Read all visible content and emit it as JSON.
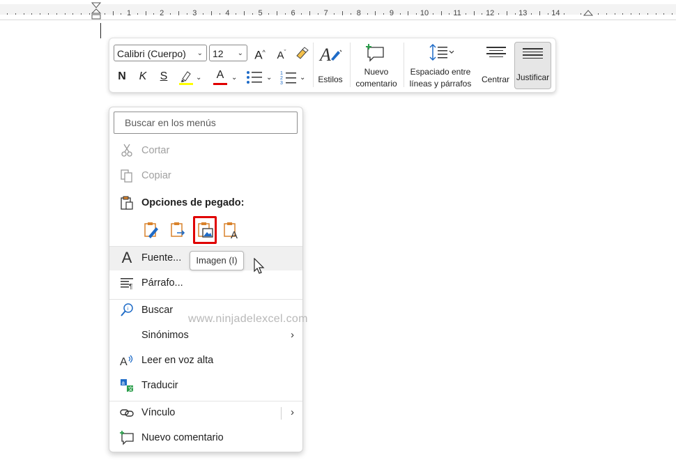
{
  "ruler": {
    "numbers": [
      "1",
      "2",
      "3",
      "4",
      "5",
      "6",
      "7",
      "8",
      "9",
      "10",
      "11",
      "12",
      "13",
      "14"
    ]
  },
  "toolbar": {
    "font_name": "Calibri (Cuerpo)",
    "font_size": "12",
    "grow_font": "A^",
    "shrink_font": "Aˇ",
    "bold": "N",
    "italic": "K",
    "underline": "S",
    "font_color_letter": "A",
    "highlight_color": "#ffff00",
    "font_color": "#e00000",
    "styles_label": "Estilos",
    "new_comment_label_1": "Nuevo",
    "new_comment_label_2": "comentario",
    "spacing_label_1": "Espaciado entre",
    "spacing_label_2": "líneas y párrafos",
    "center_label": "Centrar",
    "justify_label": "Justificar"
  },
  "menu": {
    "search_placeholder": "Buscar en los menús",
    "cut": "Cortar",
    "copy": "Copiar",
    "paste_options": "Opciones de pegado:",
    "font": "Fuente...",
    "paragraph": "Párrafo...",
    "search": "Buscar",
    "synonyms": "Sinónimos",
    "read_aloud": "Leer en voz alta",
    "translate": "Traducir",
    "link": "Vínculo",
    "new_comment": "Nuevo comentario"
  },
  "tooltip": {
    "text": "Imagen (I)"
  },
  "watermark": {
    "text": "www.ninjadelexcel.com"
  },
  "colors": {
    "accent_blue": "#1e6bc7",
    "paste_orange": "#d9822b",
    "selection_red": "#e00000"
  }
}
